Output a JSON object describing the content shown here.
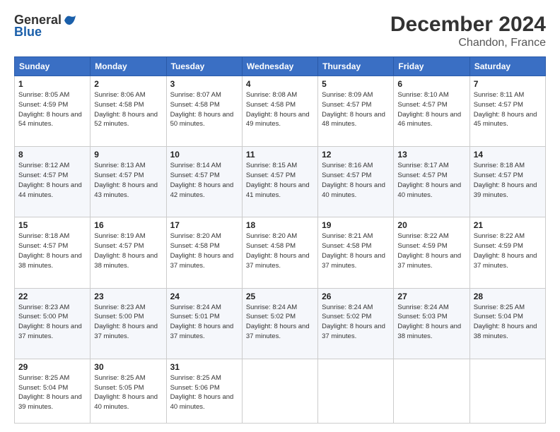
{
  "header": {
    "logo_general": "General",
    "logo_blue": "Blue",
    "month_title": "December 2024",
    "location": "Chandon, France"
  },
  "weekdays": [
    "Sunday",
    "Monday",
    "Tuesday",
    "Wednesday",
    "Thursday",
    "Friday",
    "Saturday"
  ],
  "weeks": [
    [
      {
        "day": "1",
        "sunrise": "8:05 AM",
        "sunset": "4:59 PM",
        "daylight": "8 hours and 54 minutes."
      },
      {
        "day": "2",
        "sunrise": "8:06 AM",
        "sunset": "4:58 PM",
        "daylight": "8 hours and 52 minutes."
      },
      {
        "day": "3",
        "sunrise": "8:07 AM",
        "sunset": "4:58 PM",
        "daylight": "8 hours and 50 minutes."
      },
      {
        "day": "4",
        "sunrise": "8:08 AM",
        "sunset": "4:58 PM",
        "daylight": "8 hours and 49 minutes."
      },
      {
        "day": "5",
        "sunrise": "8:09 AM",
        "sunset": "4:57 PM",
        "daylight": "8 hours and 48 minutes."
      },
      {
        "day": "6",
        "sunrise": "8:10 AM",
        "sunset": "4:57 PM",
        "daylight": "8 hours and 46 minutes."
      },
      {
        "day": "7",
        "sunrise": "8:11 AM",
        "sunset": "4:57 PM",
        "daylight": "8 hours and 45 minutes."
      }
    ],
    [
      {
        "day": "8",
        "sunrise": "8:12 AM",
        "sunset": "4:57 PM",
        "daylight": "8 hours and 44 minutes."
      },
      {
        "day": "9",
        "sunrise": "8:13 AM",
        "sunset": "4:57 PM",
        "daylight": "8 hours and 43 minutes."
      },
      {
        "day": "10",
        "sunrise": "8:14 AM",
        "sunset": "4:57 PM",
        "daylight": "8 hours and 42 minutes."
      },
      {
        "day": "11",
        "sunrise": "8:15 AM",
        "sunset": "4:57 PM",
        "daylight": "8 hours and 41 minutes."
      },
      {
        "day": "12",
        "sunrise": "8:16 AM",
        "sunset": "4:57 PM",
        "daylight": "8 hours and 40 minutes."
      },
      {
        "day": "13",
        "sunrise": "8:17 AM",
        "sunset": "4:57 PM",
        "daylight": "8 hours and 40 minutes."
      },
      {
        "day": "14",
        "sunrise": "8:18 AM",
        "sunset": "4:57 PM",
        "daylight": "8 hours and 39 minutes."
      }
    ],
    [
      {
        "day": "15",
        "sunrise": "8:18 AM",
        "sunset": "4:57 PM",
        "daylight": "8 hours and 38 minutes."
      },
      {
        "day": "16",
        "sunrise": "8:19 AM",
        "sunset": "4:57 PM",
        "daylight": "8 hours and 38 minutes."
      },
      {
        "day": "17",
        "sunrise": "8:20 AM",
        "sunset": "4:58 PM",
        "daylight": "8 hours and 37 minutes."
      },
      {
        "day": "18",
        "sunrise": "8:20 AM",
        "sunset": "4:58 PM",
        "daylight": "8 hours and 37 minutes."
      },
      {
        "day": "19",
        "sunrise": "8:21 AM",
        "sunset": "4:58 PM",
        "daylight": "8 hours and 37 minutes."
      },
      {
        "day": "20",
        "sunrise": "8:22 AM",
        "sunset": "4:59 PM",
        "daylight": "8 hours and 37 minutes."
      },
      {
        "day": "21",
        "sunrise": "8:22 AM",
        "sunset": "4:59 PM",
        "daylight": "8 hours and 37 minutes."
      }
    ],
    [
      {
        "day": "22",
        "sunrise": "8:23 AM",
        "sunset": "5:00 PM",
        "daylight": "8 hours and 37 minutes."
      },
      {
        "day": "23",
        "sunrise": "8:23 AM",
        "sunset": "5:00 PM",
        "daylight": "8 hours and 37 minutes."
      },
      {
        "day": "24",
        "sunrise": "8:24 AM",
        "sunset": "5:01 PM",
        "daylight": "8 hours and 37 minutes."
      },
      {
        "day": "25",
        "sunrise": "8:24 AM",
        "sunset": "5:02 PM",
        "daylight": "8 hours and 37 minutes."
      },
      {
        "day": "26",
        "sunrise": "8:24 AM",
        "sunset": "5:02 PM",
        "daylight": "8 hours and 37 minutes."
      },
      {
        "day": "27",
        "sunrise": "8:24 AM",
        "sunset": "5:03 PM",
        "daylight": "8 hours and 38 minutes."
      },
      {
        "day": "28",
        "sunrise": "8:25 AM",
        "sunset": "5:04 PM",
        "daylight": "8 hours and 38 minutes."
      }
    ],
    [
      {
        "day": "29",
        "sunrise": "8:25 AM",
        "sunset": "5:04 PM",
        "daylight": "8 hours and 39 minutes."
      },
      {
        "day": "30",
        "sunrise": "8:25 AM",
        "sunset": "5:05 PM",
        "daylight": "8 hours and 40 minutes."
      },
      {
        "day": "31",
        "sunrise": "8:25 AM",
        "sunset": "5:06 PM",
        "daylight": "8 hours and 40 minutes."
      },
      null,
      null,
      null,
      null
    ]
  ]
}
